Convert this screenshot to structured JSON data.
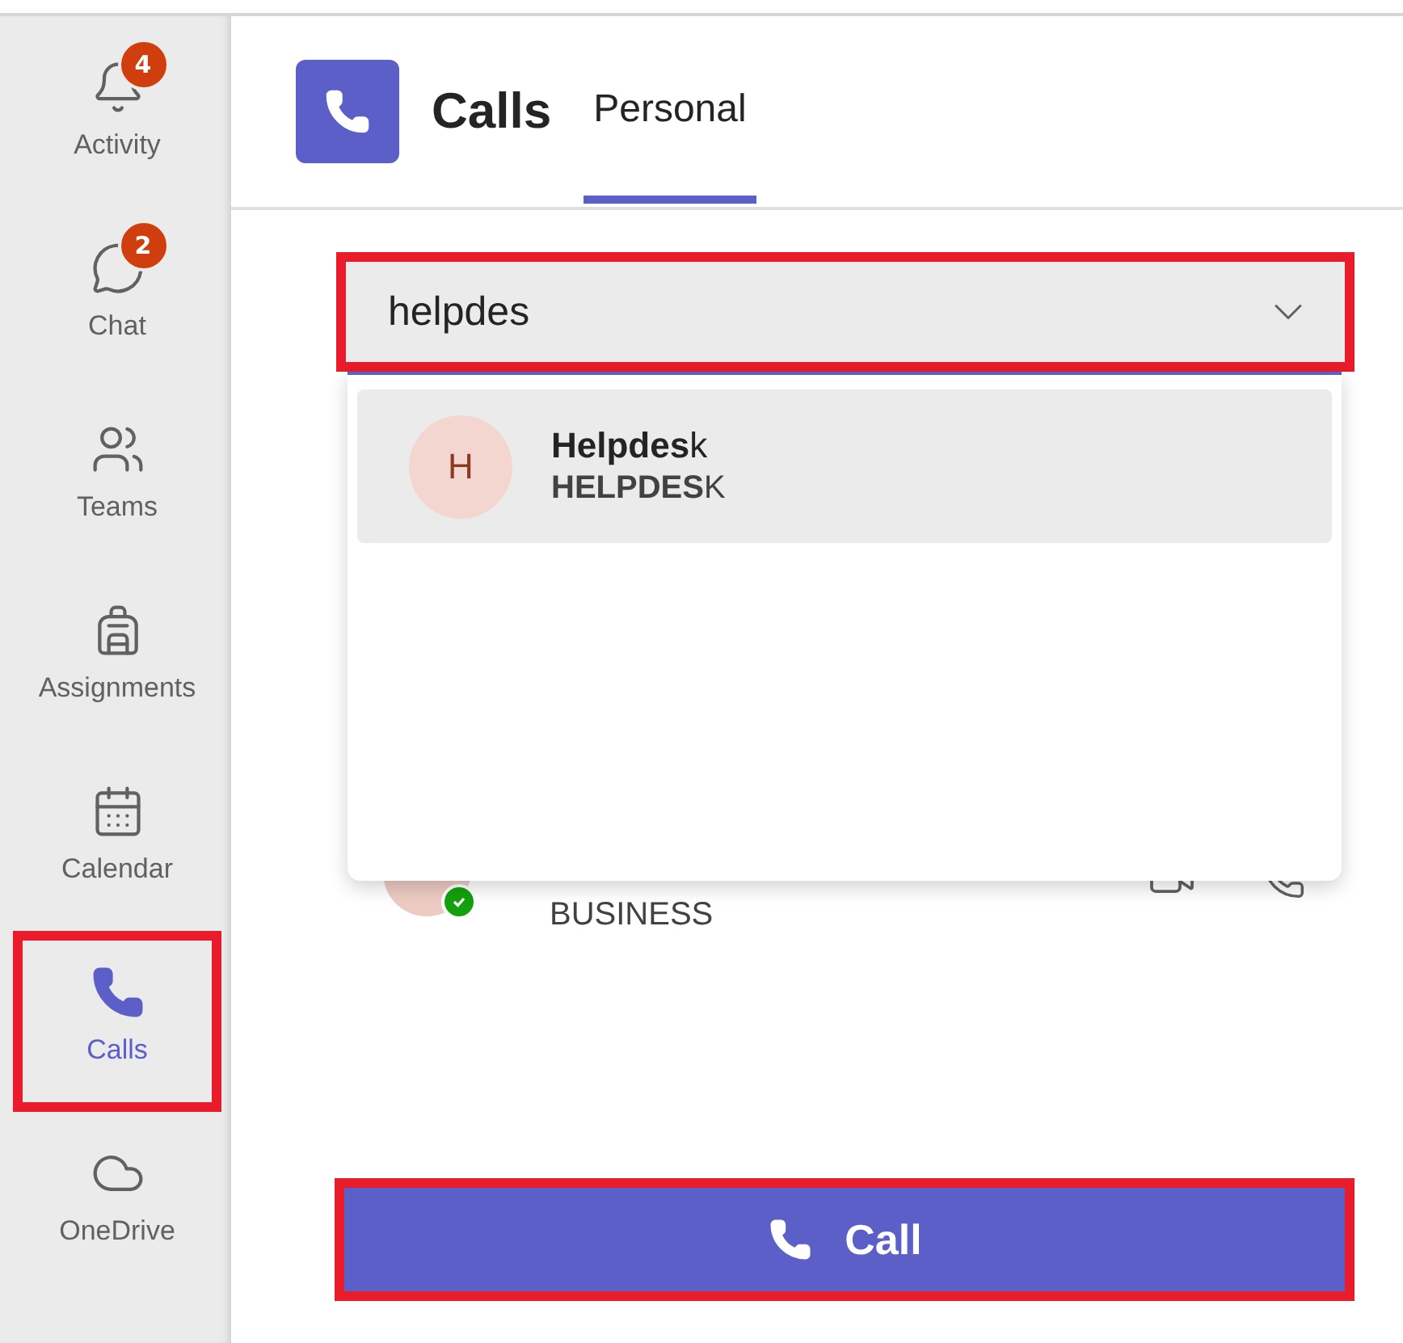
{
  "sidebar": {
    "items": [
      {
        "label": "Activity",
        "badge": "4",
        "selected": false,
        "highlighted": false
      },
      {
        "label": "Chat",
        "badge": "2",
        "selected": false,
        "highlighted": false
      },
      {
        "label": "Teams",
        "selected": false,
        "highlighted": false
      },
      {
        "label": "Assignments",
        "selected": false,
        "highlighted": false
      },
      {
        "label": "Calendar",
        "selected": false,
        "highlighted": false
      },
      {
        "label": "Calls",
        "selected": true,
        "highlighted": true
      },
      {
        "label": "OneDrive",
        "selected": false,
        "highlighted": false
      }
    ]
  },
  "header": {
    "title": "Calls",
    "tabs": [
      {
        "label": "Personal",
        "selected": true
      }
    ]
  },
  "search": {
    "value": "helpdes",
    "highlighted": true
  },
  "suggestions": [
    {
      "initial": "H",
      "name": "**Helpdes**k",
      "subtitle": "**HELPDES**K",
      "selected": true
    }
  ],
  "contacts": [
    {
      "subtitle": "BUSINESS",
      "online": true
    }
  ],
  "call_button": {
    "label": "Call",
    "highlighted": true
  }
}
